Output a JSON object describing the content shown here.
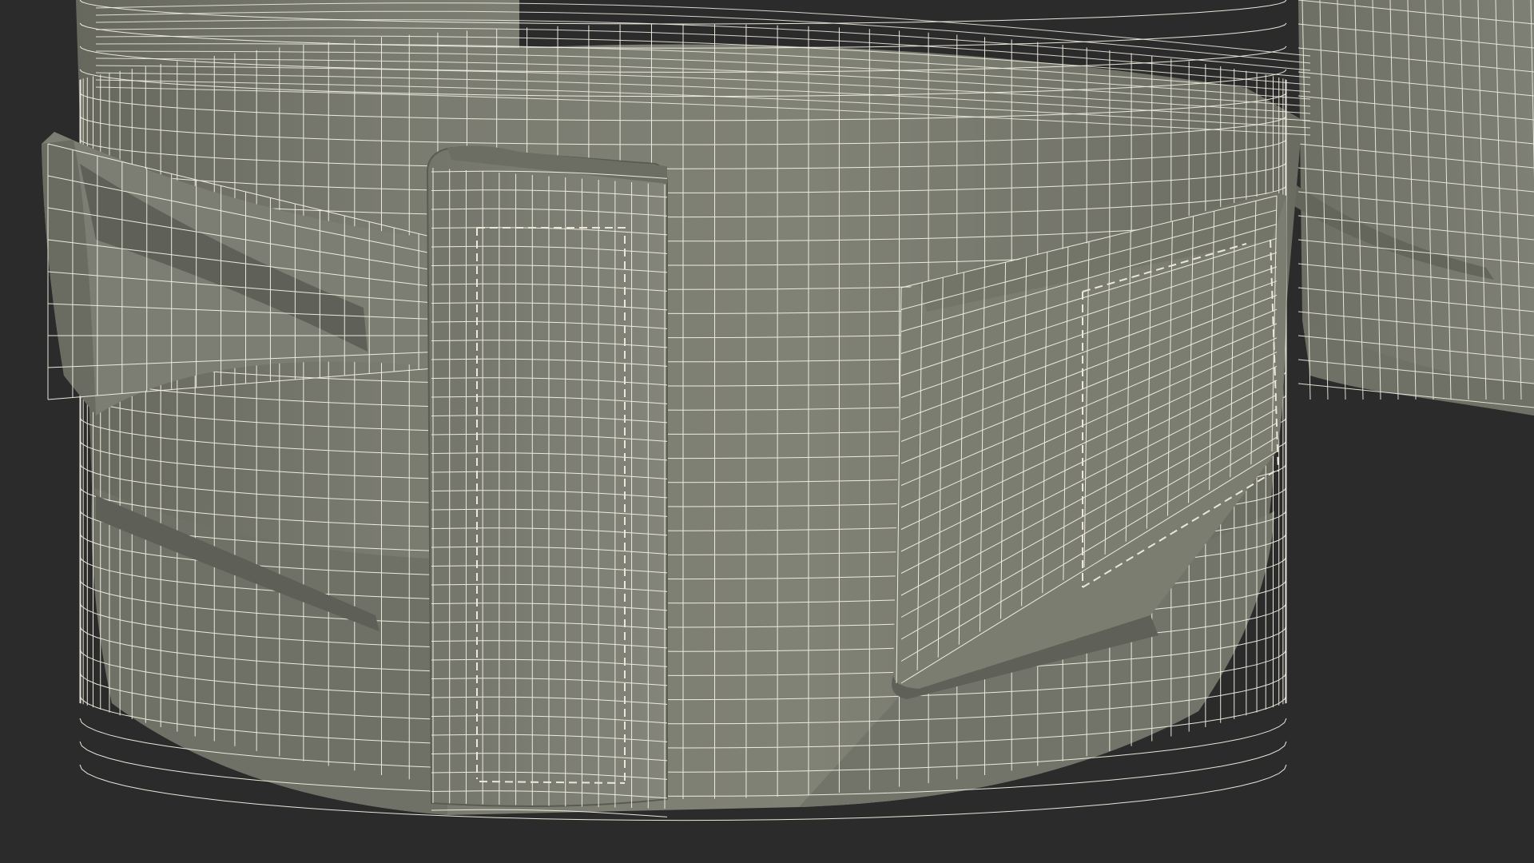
{
  "scene": {
    "subject": "wireframe-render-of-rolled-bandage-with-velcro-straps",
    "colors": {
      "background": "#2b2b2b",
      "surface": "#7c7d71",
      "surface_dark": "#6b6c62",
      "surface_light": "#8a8b7f",
      "wire": "#f4f1e4",
      "stitch": "#ece8d8"
    }
  }
}
